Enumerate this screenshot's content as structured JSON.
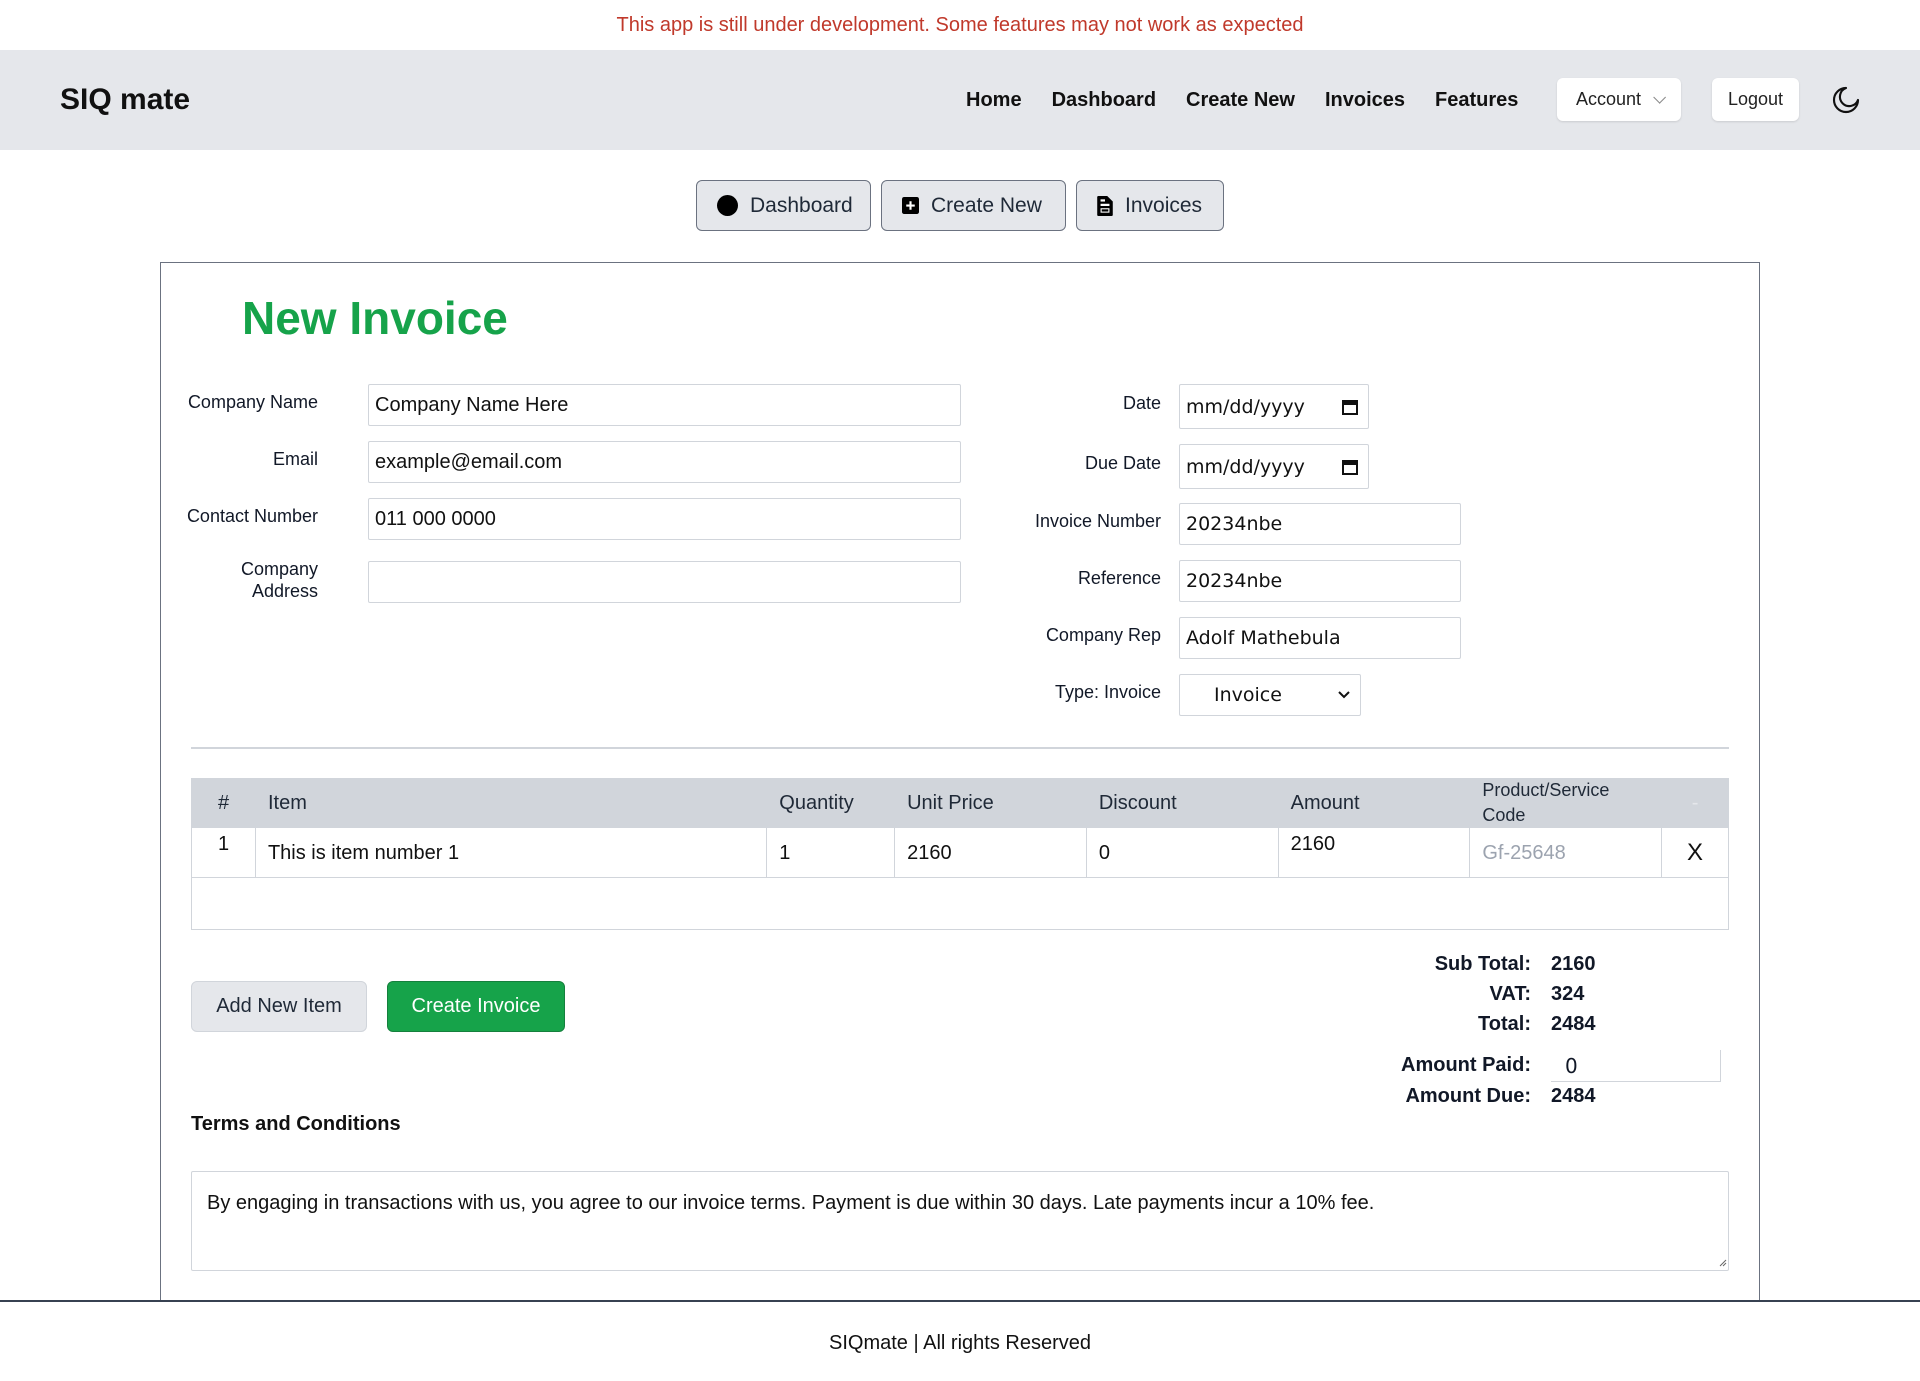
{
  "banner": {
    "text": "This app is still under development. Some features may not work as expected",
    "color": "#c0392b"
  },
  "navbar": {
    "brand": "SIQ mate",
    "links": [
      "Home",
      "Dashboard",
      "Create New",
      "Invoices",
      "Features"
    ],
    "account_label": "Account",
    "logout_label": "Logout",
    "theme_icon": "moon-icon"
  },
  "subnav": [
    {
      "label": "Dashboard",
      "icon": "circle-icon"
    },
    {
      "label": "Create New",
      "icon": "plus-square-icon"
    },
    {
      "label": "Invoices",
      "icon": "file-icon"
    }
  ],
  "form": {
    "title": "New Invoice",
    "title_color": "#16a34a",
    "left": [
      {
        "label": "Company Name",
        "value": "Company Name Here"
      },
      {
        "label": "Email",
        "value": "example@email.com"
      },
      {
        "label": "Contact Number",
        "value": "011 000 0000"
      },
      {
        "label": "Company Address",
        "value": ""
      }
    ],
    "right": {
      "date": {
        "label": "Date",
        "placeholder": "mm/dd/yyyy"
      },
      "due_date": {
        "label": "Due Date",
        "placeholder": "mm/dd/yyyy"
      },
      "invoice_number": {
        "label": "Invoice Number",
        "value": "20234nbe"
      },
      "reference": {
        "label": "Reference",
        "value": "20234nbe"
      },
      "company_rep": {
        "label": "Company Rep",
        "value": "Adolf Mathebula"
      },
      "type": {
        "label": "Type: Invoice",
        "selected": "Invoice"
      }
    }
  },
  "table": {
    "headers": [
      "#",
      "Item",
      "Quantity",
      "Unit Price",
      "Discount",
      "Amount",
      "Product/Service Code",
      "-"
    ],
    "rows": [
      {
        "num": "1",
        "item": "This is item number 1",
        "quantity": "1",
        "unit_price": "2160",
        "discount": "0",
        "amount": "2160",
        "code_placeholder": "Gf-25648",
        "remove": "X"
      }
    ]
  },
  "actions": {
    "add_item": "Add New Item",
    "create_invoice": "Create Invoice"
  },
  "totals": {
    "sub_total_label": "Sub Total:",
    "sub_total": "2160",
    "vat_label": "VAT:",
    "vat": "324",
    "total_label": "Total:",
    "total": "2484",
    "amount_paid_label": "Amount Paid:",
    "amount_paid": "0",
    "amount_due_label": "Amount Due:",
    "amount_due": "2484"
  },
  "terms": {
    "heading": "Terms and Conditions",
    "text": "By engaging in transactions with us, you agree to our invoice terms. Payment is due within 30 days. Late payments incur a 10% fee."
  },
  "footer": {
    "text": "SIQmate | All rights Reserved"
  }
}
